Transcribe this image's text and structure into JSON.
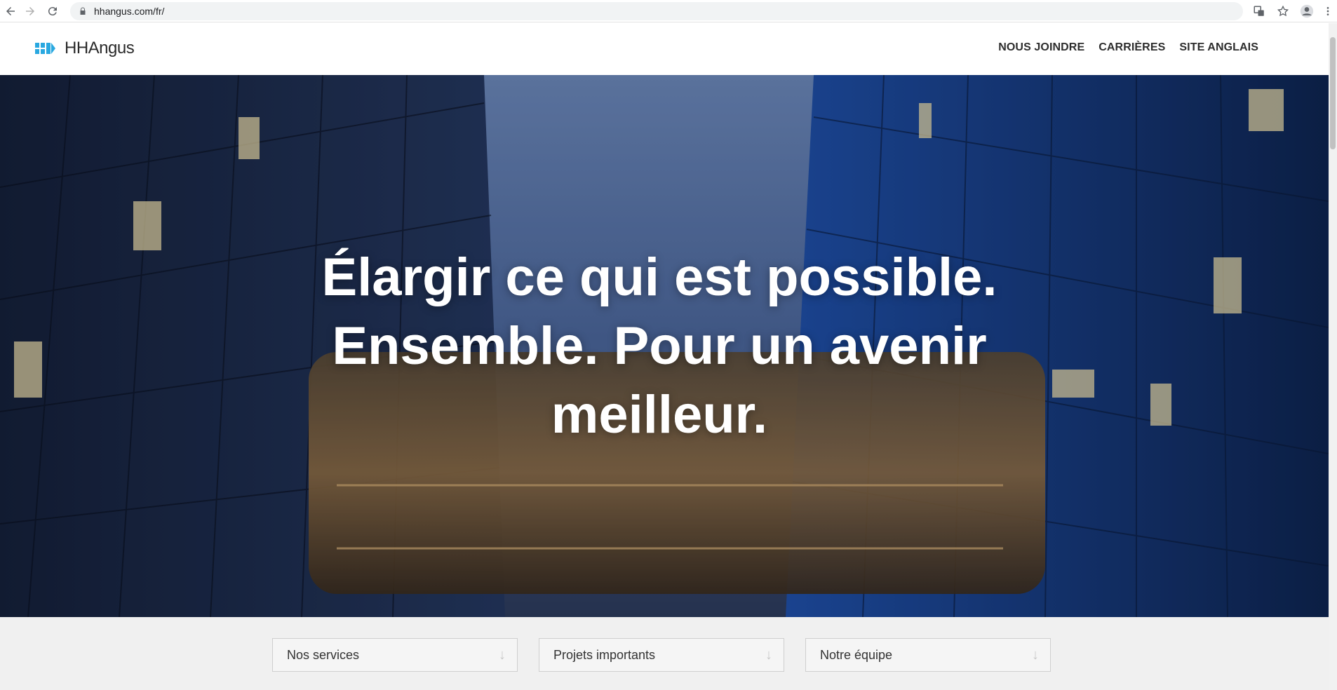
{
  "browser": {
    "url": "hhangus.com/fr/"
  },
  "header": {
    "logo_text": "HHAngus",
    "nav": [
      {
        "label": "NOUS JOINDRE"
      },
      {
        "label": "CARRIÈRES"
      },
      {
        "label": "SITE ANGLAIS"
      }
    ]
  },
  "hero": {
    "lines": [
      "Élargir ce qui est possible.",
      "Ensemble. Pour un avenir",
      "meilleur."
    ]
  },
  "quicklinks": [
    {
      "label": "Nos services"
    },
    {
      "label": "Projets importants"
    },
    {
      "label": "Notre équipe"
    }
  ],
  "colors": {
    "brand": "#29a8e0"
  }
}
